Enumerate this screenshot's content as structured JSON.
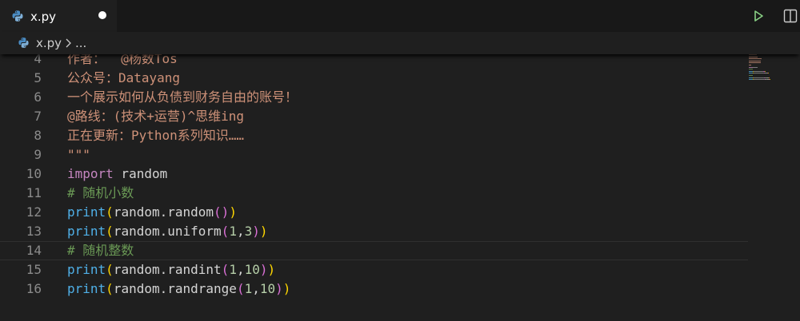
{
  "tab": {
    "label": "x.py",
    "icon": "python-icon"
  },
  "actions": {
    "run_icon": "run-triangle-icon",
    "split_icon": "split-editor-icon"
  },
  "breadcrumb": {
    "file": "x.py",
    "more": "..."
  },
  "colors": {
    "string": "#ce9178",
    "keyword": "#c586c0",
    "function": "#4fb0e8",
    "comment": "#6a9955",
    "number": "#b5cea8",
    "bracket_yellow": "#ffd700",
    "bracket_magenta": "#da70d6",
    "run_green": "#89d185"
  },
  "editor": {
    "lines": [
      {
        "num": "4",
        "tokens": [
          {
            "t": "作者：  @杨数Tos",
            "c": "str"
          }
        ]
      },
      {
        "num": "5",
        "tokens": [
          {
            "t": "公众号：Datayang",
            "c": "str"
          }
        ]
      },
      {
        "num": "6",
        "tokens": [
          {
            "t": "一个展示如何从负债到财务自由的账号！",
            "c": "str"
          }
        ]
      },
      {
        "num": "7",
        "tokens": [
          {
            "t": "@路线：(技术+运营)^思维ing",
            "c": "str"
          }
        ]
      },
      {
        "num": "8",
        "tokens": [
          {
            "t": "正在更新：Python系列知识……",
            "c": "str"
          }
        ]
      },
      {
        "num": "9",
        "tokens": [
          {
            "t": "\"\"\"",
            "c": "str"
          }
        ]
      },
      {
        "num": "10",
        "tokens": [
          {
            "t": "import",
            "c": "kw"
          },
          {
            "t": " random",
            "c": "id"
          }
        ]
      },
      {
        "num": "11",
        "tokens": [
          {
            "t": "# 随机小数",
            "c": "cmt"
          }
        ]
      },
      {
        "num": "12",
        "tokens": [
          {
            "t": "print",
            "c": "fn"
          },
          {
            "t": "(",
            "c": "p1"
          },
          {
            "t": "random.random",
            "c": "id"
          },
          {
            "t": "()",
            "c": "p2"
          },
          {
            "t": ")",
            "c": "p1"
          }
        ]
      },
      {
        "num": "13",
        "tokens": [
          {
            "t": "print",
            "c": "fn"
          },
          {
            "t": "(",
            "c": "p1"
          },
          {
            "t": "random.uniform",
            "c": "id"
          },
          {
            "t": "(",
            "c": "p2"
          },
          {
            "t": "1",
            "c": "num"
          },
          {
            "t": ",",
            "c": "id"
          },
          {
            "t": "3",
            "c": "num"
          },
          {
            "t": ")",
            "c": "p2"
          },
          {
            "t": ")",
            "c": "p1"
          }
        ]
      },
      {
        "num": "14",
        "tokens": [
          {
            "t": "# 随机整数",
            "c": "cmt"
          }
        ],
        "current": true
      },
      {
        "num": "15",
        "tokens": [
          {
            "t": "print",
            "c": "fn"
          },
          {
            "t": "(",
            "c": "p1"
          },
          {
            "t": "random.randint",
            "c": "id"
          },
          {
            "t": "(",
            "c": "p2"
          },
          {
            "t": "1",
            "c": "num"
          },
          {
            "t": ",",
            "c": "id"
          },
          {
            "t": "10",
            "c": "num"
          },
          {
            "t": ")",
            "c": "p2"
          },
          {
            "t": ")",
            "c": "p1"
          }
        ]
      },
      {
        "num": "16",
        "tokens": [
          {
            "t": "print",
            "c": "fn"
          },
          {
            "t": "(",
            "c": "p1"
          },
          {
            "t": "random.randrange",
            "c": "id"
          },
          {
            "t": "(",
            "c": "p2"
          },
          {
            "t": "1",
            "c": "num"
          },
          {
            "t": ",",
            "c": "id"
          },
          {
            "t": "10",
            "c": "num"
          },
          {
            "t": ")",
            "c": "p2"
          },
          {
            "t": ")",
            "c": "p1"
          }
        ]
      }
    ]
  }
}
